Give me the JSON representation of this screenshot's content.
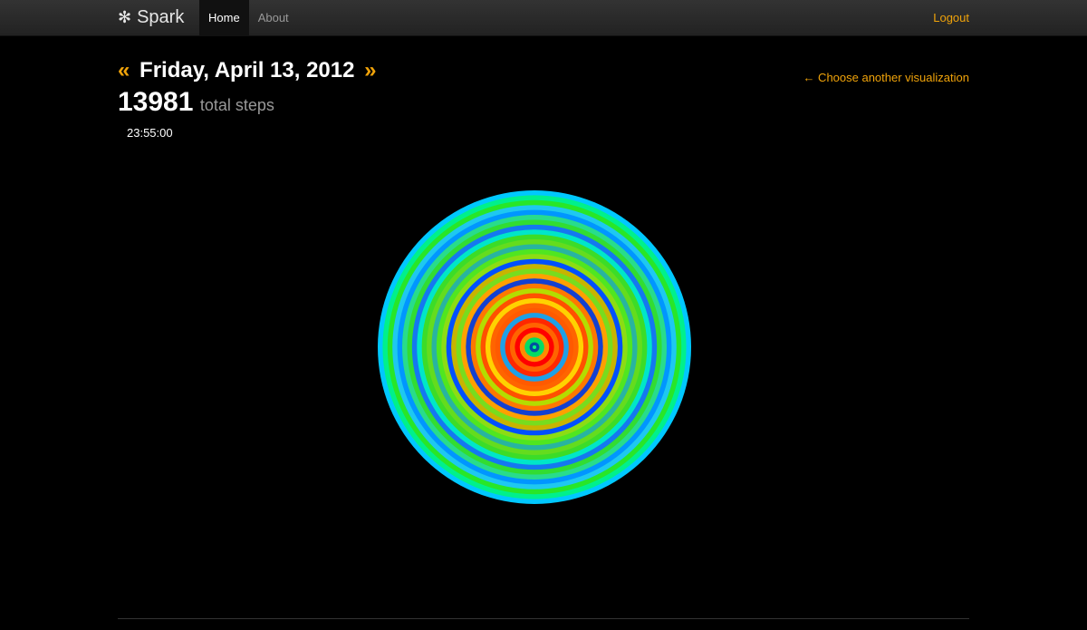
{
  "brand": {
    "name": "Spark",
    "icon": "asterisk-icon"
  },
  "nav": {
    "items": [
      {
        "label": "Home",
        "active": true
      },
      {
        "label": "About",
        "active": false
      }
    ]
  },
  "logout_label": "Logout",
  "header": {
    "prev_arrow": "«",
    "date": "Friday, April 13, 2012",
    "next_arrow": "»",
    "steps": "13981",
    "steps_label": "total steps",
    "time": "23:55:00",
    "choose_link": "← Choose another visualization"
  },
  "colors": {
    "accent": "#f0a30a",
    "background": "#000000",
    "nav_bg": "#2b2b2b"
  },
  "visualization": {
    "type": "concentric-rings",
    "rings_outer_to_inner": [
      "#00c8ff",
      "#00f08c",
      "#28e628",
      "#1ec8f0",
      "#0096ff",
      "#28dc8c",
      "#32dc32",
      "#1478f0",
      "#00e6c8",
      "#3cdc28",
      "#64dc1e",
      "#28b4a0",
      "#50e620",
      "#8cdc14",
      "#0050ff",
      "#c8b400",
      "#78dc1e",
      "#ffa000",
      "#1440d0",
      "#ff7800",
      "#b4dc00",
      "#ff5000",
      "#ffd200",
      "#ff6400",
      "#ff5a00",
      "#1ea0e6",
      "#ff2800",
      "#ff6400",
      "#ff0000",
      "#ff8c00",
      "#00dc64",
      "#0050a0"
    ]
  }
}
